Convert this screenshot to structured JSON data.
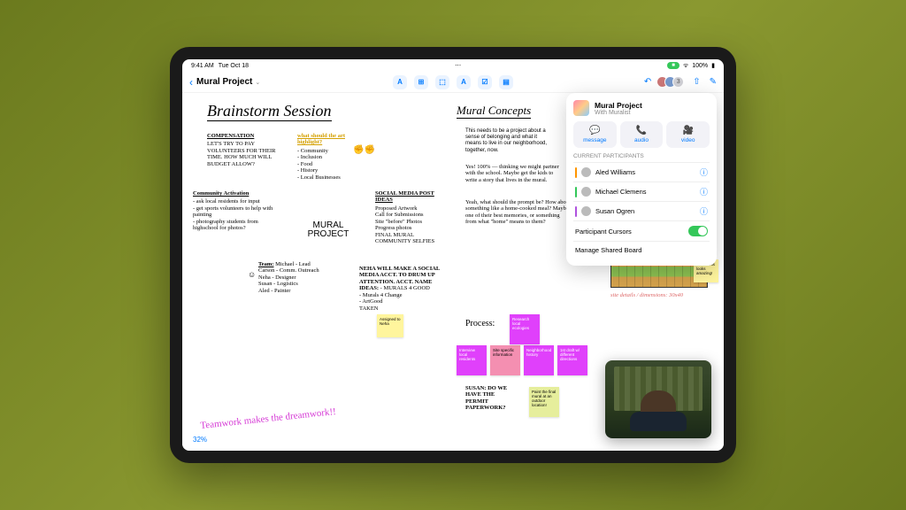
{
  "statusbar": {
    "time": "9:41 AM",
    "date": "Tue Oct 18",
    "battery": "100%"
  },
  "toolbar": {
    "title": "Mural Project",
    "tools": [
      "A",
      "⊞",
      "⬚",
      "A",
      "☑",
      "▤"
    ]
  },
  "popover": {
    "title": "Mural Project",
    "subtitle": "With Muralist",
    "actions": [
      {
        "icon": "💬",
        "label": "message"
      },
      {
        "icon": "📞",
        "label": "audio"
      },
      {
        "icon": "🎥",
        "label": "video"
      }
    ],
    "sectionLabel": "CURRENT PARTICIPANTS",
    "participants": [
      {
        "name": "Aled Williams",
        "color": "or"
      },
      {
        "name": "Michael Clemens",
        "color": "gr"
      },
      {
        "name": "Susan Ogren",
        "color": "pu"
      }
    ],
    "cursorsLabel": "Participant Cursors",
    "manageLabel": "Manage Shared Board",
    "avatarCount": "3"
  },
  "canvas": {
    "heading1": "Brainstorm Session",
    "heading2": "Mural Concepts",
    "muralBadge": "MURAL PROJECT",
    "zoom": "32%",
    "teamwork": "Teamwork makes the dreamwork!!",
    "compensation": {
      "title": "COMPENSATION",
      "body": "LET'S TRY TO PAY VOLUNTEERS FOR THEIR TIME. HOW MUCH WILL BUDGET ALLOW?"
    },
    "highlight": {
      "title": "what should the art highlight?",
      "items": "- Community\n- Inclusion\n- Food\n- History\n- Local Businesses"
    },
    "social": {
      "title": "SOCIAL MEDIA POST IDEAS",
      "items": "Proposed Artwork\nCall for Submissions\nSite \"before\" Photos\nProgress photos\nFINAL MURAL\nCOMMUNITY SELFIES"
    },
    "activation": {
      "title": "Community Activation",
      "body": "- ask local residents for input\n- get sports volunteers to help with painting\n- photography students from highschool for photos?"
    },
    "team": {
      "title": "Team:",
      "body": "Michael - Lead\nCarson - Comm. Outreach\nNeha - Designer\nSusan - Logistics\nAled - Painter"
    },
    "neha": {
      "title": "NEHA WILL MAKE A SOCIAL MEDIA ACCT. TO DRUM UP ATTENTION. ACCT. NAME IDEAS:",
      "body": "- MURALS 4 GOOD\n- Murals 4 Change\n- ArtGood\nTAKEN"
    },
    "conceptDesc": "This needs to be a project about a sense of belonging and what it means to live in our neighborhood, together, now.",
    "conceptReply1": "Yes! 100% — thinking we might partner with the school. Maybe get the kids to write a story that lives in the mural.",
    "conceptReply2": "Yeah, what should the prompt be? How about something like a home-cooked meal? Maybe one of their best memories, or something from what \"home\" means to them?",
    "siteDetails": "site details / dimensions: 30x40",
    "processLabel": "Process:",
    "stickies": {
      "assigned": "Assigned to Neha",
      "wow": "Wow! This looks amazing!",
      "interview": "Interview local residents",
      "siteinfo": "Site specific information",
      "history": "Neighborhood history",
      "draft": "1st draft w/ different directions",
      "research": "Research local ecologies",
      "paint": "Paint the final mural at an outdoor location!",
      "permit": "SUSAN: DO WE HAVE THE PERMIT PAPERWORK?"
    }
  }
}
